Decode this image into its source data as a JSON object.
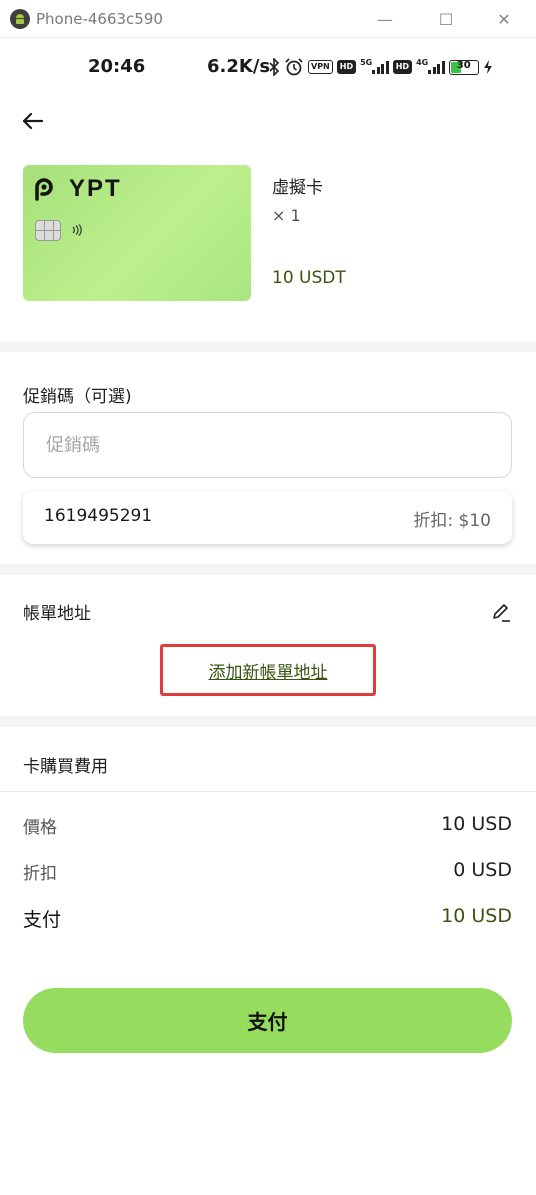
{
  "window": {
    "title": "Phone-4663c590",
    "minimize_glyph": "—",
    "maximize_glyph": "☐",
    "close_glyph": "✕"
  },
  "status_bar": {
    "time": "20:46",
    "speed": "6.2K/s",
    "vpn_tag": "VPN",
    "hd_tag_1": "HD",
    "net_1": "5G",
    "hd_tag_2": "HD",
    "net_2": "4G",
    "battery": "30"
  },
  "card": {
    "brand": "YPT",
    "color_light": "#bdf08c",
    "color_dark": "#a6e07a"
  },
  "product": {
    "name": "虛擬卡",
    "quantity": "× 1",
    "price": "10 USDT"
  },
  "promo": {
    "label": "促銷碼（可選)",
    "placeholder": "促銷碼",
    "coupon_code": "1619495291",
    "coupon_discount": "折扣: $10"
  },
  "billing": {
    "label": "帳單地址",
    "add_link": "添加新帳單地址"
  },
  "fees": {
    "title": "卡購買費用",
    "rows": [
      {
        "label": "價格",
        "value": "10 USD"
      },
      {
        "label": "折扣",
        "value": "0 USD"
      },
      {
        "label": "支付",
        "value": "10 USD"
      }
    ]
  },
  "pay_button": "支付",
  "colors": {
    "accent": "#96dc5f",
    "price_text": "#3d5410",
    "highlight_box": "#e23b3b"
  }
}
